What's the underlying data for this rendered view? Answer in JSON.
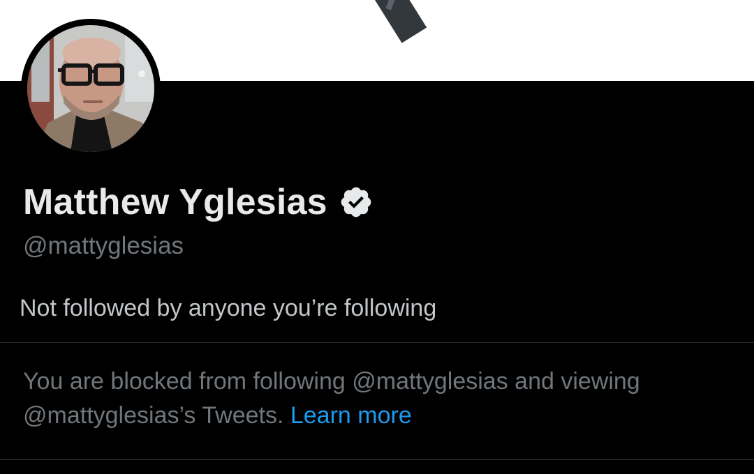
{
  "profile": {
    "display_name": "Matthew Yglesias",
    "handle": "@mattyglesias",
    "verified": true,
    "followed_by_text": "Not followed by anyone you’re following"
  },
  "blocked": {
    "message_line1": "You are blocked from following @mattyglesias and viewing",
    "message_line2": "@mattyglesias’s Tweets.",
    "link_label": "Learn more"
  },
  "colors": {
    "background": "#000000",
    "banner": "#ffffff",
    "primary_text": "#e7e9ea",
    "secondary_text": "#71767b",
    "link": "#1d9bf0",
    "divider": "#2f3336"
  },
  "icons": {
    "verified": "verified-badge-icon",
    "avatar": "profile-photo"
  }
}
